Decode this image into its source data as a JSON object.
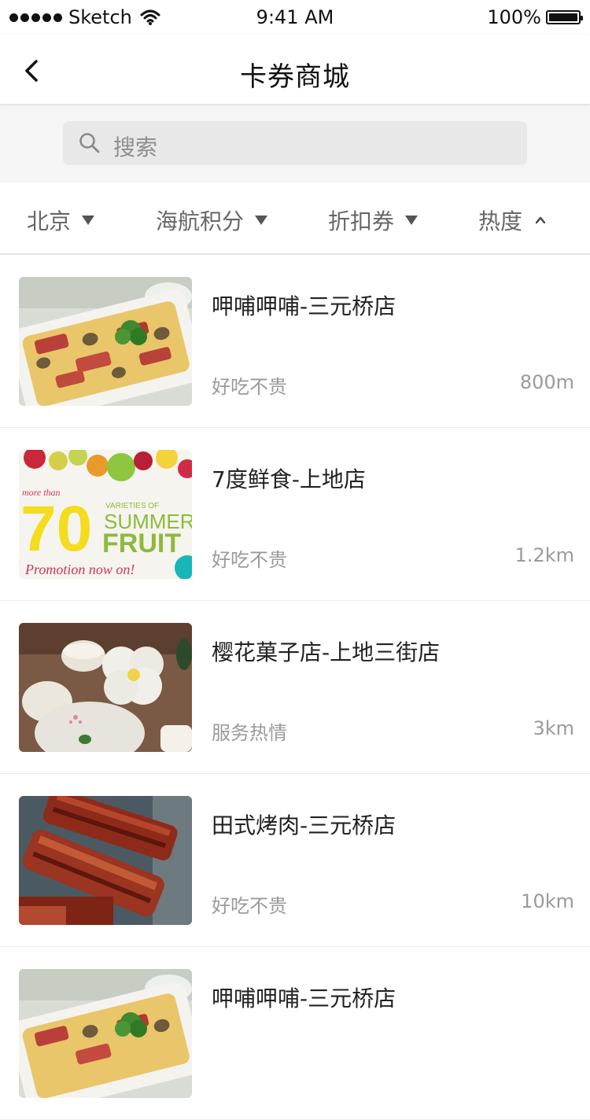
{
  "status": {
    "carrier": "Sketch",
    "time": "9:41 AM",
    "battery": "100%"
  },
  "nav": {
    "title": "卡券商城",
    "back_icon": "chevron-left-icon"
  },
  "search": {
    "placeholder": "搜索",
    "icon": "search-icon"
  },
  "filters": [
    {
      "label": "北京",
      "indicator": "caret-down"
    },
    {
      "label": "海航积分",
      "indicator": "caret-down"
    },
    {
      "label": "折扣券",
      "indicator": "caret-down"
    },
    {
      "label": "热度",
      "indicator": "chevron-up"
    }
  ],
  "items": [
    {
      "name": "呷哺呷哺-三元桥店",
      "desc": "好吃不贵",
      "distance": "800m",
      "image": "casserole-photo"
    },
    {
      "name": "7度鲜食-上地店",
      "desc": "好吃不贵",
      "distance": "1.2km",
      "image": "summer-fruit-poster",
      "poster": {
        "top": "more than",
        "big": "70",
        "line1": "VARIETIES OF",
        "line2": "SUMMER",
        "line3": "FRUIT",
        "bottom": "Promotion now on!"
      }
    },
    {
      "name": "樱花菓子店-上地三街店",
      "desc": "服务热情",
      "distance": "3km",
      "image": "mochi-sweets-photo"
    },
    {
      "name": "田式烤肉-三元桥店",
      "desc": "好吃不贵",
      "distance": "10km",
      "image": "grilled-ribs-photo"
    },
    {
      "name": "呷哺呷哺-三元桥店",
      "desc": "",
      "distance": "",
      "image": "casserole-photo"
    }
  ]
}
